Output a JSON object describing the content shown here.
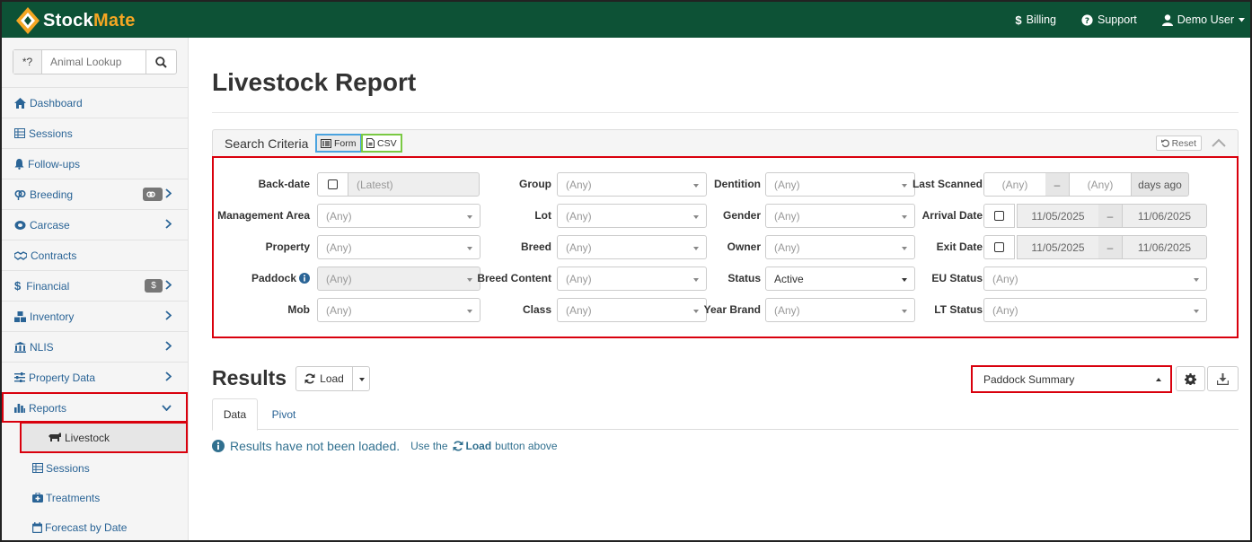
{
  "brand": {
    "name_part1": "Stock",
    "name_part2": "Mate",
    "accent_color": "#f5a623",
    "bar_color": "#0d5236"
  },
  "topnav": {
    "billing": "Billing",
    "support": "Support",
    "user": "Demo User"
  },
  "sidebar": {
    "search_prefix": "*?",
    "search_placeholder": "Animal Lookup",
    "items": [
      {
        "label": "Dashboard",
        "icon": "home-icon"
      },
      {
        "label": "Sessions",
        "icon": "table-icon"
      },
      {
        "label": "Follow-ups",
        "icon": "bell-icon"
      },
      {
        "label": "Breeding",
        "icon": "gender-icon",
        "badge_icon": "gender-icon"
      },
      {
        "label": "Carcase",
        "icon": "meat-icon"
      },
      {
        "label": "Contracts",
        "icon": "handshake-icon"
      },
      {
        "label": "Financial",
        "icon": "dollar-icon",
        "badge": "$"
      },
      {
        "label": "Inventory",
        "icon": "boxes-icon"
      },
      {
        "label": "NLIS",
        "icon": "bank-icon"
      },
      {
        "label": "Property Data",
        "icon": "sliders-icon"
      },
      {
        "label": "Reports",
        "icon": "bar-chart-icon"
      }
    ],
    "sub_items": [
      {
        "label": "Livestock",
        "icon": "livestock-icon"
      },
      {
        "label": "Sessions",
        "icon": "table-icon"
      },
      {
        "label": "Treatments",
        "icon": "medkit-icon"
      },
      {
        "label": "Forecast by Date",
        "icon": "calendar-icon"
      }
    ]
  },
  "page": {
    "title": "Livestock Report"
  },
  "criteria": {
    "title": "Search Criteria",
    "form_label": "Form",
    "csv_label": "CSV",
    "reset_label": "Reset",
    "any": "(Any)",
    "latest": "(Latest)",
    "days_ago": "days ago",
    "dash": "–",
    "status_value": "Active",
    "arrival_from": "11/05/2025",
    "arrival_to": "11/06/2025",
    "exit_from": "11/05/2025",
    "exit_to": "11/06/2025",
    "labels": {
      "backdate": "Back-date",
      "management_area": "Management Area",
      "property": "Property",
      "paddock": "Paddock",
      "mob": "Mob",
      "group": "Group",
      "lot": "Lot",
      "breed": "Breed",
      "breed_content": "Breed Content",
      "class": "Class",
      "dentition": "Dentition",
      "gender": "Gender",
      "owner": "Owner",
      "status": "Status",
      "year_brand": "Year Brand",
      "last_scanned": "Last Scanned",
      "arrival_date": "Arrival Date",
      "exit_date": "Exit Date",
      "eu_status": "EU Status",
      "lt_status": "LT Status"
    }
  },
  "results": {
    "title": "Results",
    "load_label": "Load",
    "report_type": "Paddock Summary",
    "tabs": [
      "Data",
      "Pivot"
    ],
    "message": "Results have not been loaded.",
    "hint_prefix": "Use the",
    "hint_button": "Load",
    "hint_suffix": "button above"
  }
}
